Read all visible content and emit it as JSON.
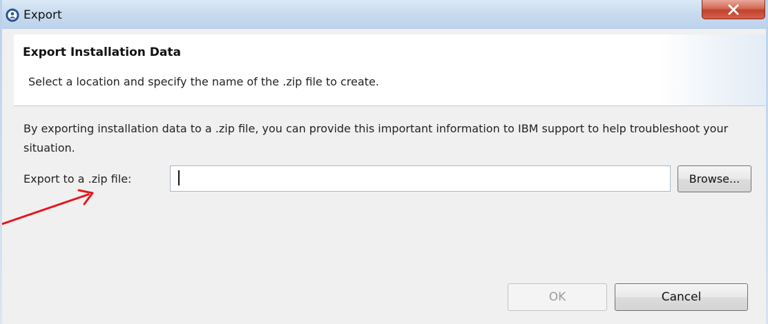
{
  "window": {
    "title": "Export",
    "icon": "eclipse-app-icon",
    "close_icon": "close-icon"
  },
  "banner": {
    "title": "Export Installation Data",
    "description": "Select a location and specify the name of the .zip file to create."
  },
  "content": {
    "info": "By exporting installation data to a .zip file, you can provide this important information to IBM support to help troubleshoot your situation.",
    "field_label": "Export to a .zip file:",
    "field_value": "",
    "browse_label": "Browse..."
  },
  "footer": {
    "ok_label": "OK",
    "ok_enabled": false,
    "cancel_label": "Cancel"
  },
  "annotation": {
    "arrow_color": "#e8141b"
  },
  "colors": {
    "close_button": "#c8462f",
    "titlebar": "#c6d9ef"
  }
}
